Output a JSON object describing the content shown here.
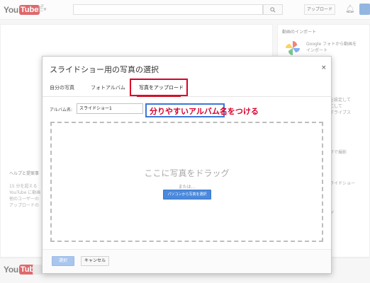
{
  "header": {
    "logo_you": "You",
    "logo_tube": "Tube",
    "logo_region": "JP",
    "guide_icon": "menu-icon",
    "search_placeholder": "",
    "upload_label": "アップロード"
  },
  "background": {
    "import_title": "動画のインポート",
    "import_desc_line1": "Google フォトから動画を",
    "import_desc_line2": "インポート",
    "right_snippets": [
      "を設定して",
      "にして",
      "すライブス",
      "ラで撮影",
      "ライドショー",
      "ゲ"
    ],
    "left_title": "ヘルプと提案事",
    "left_snippets": [
      "15 分を超える",
      "YouTube に動画",
      "他のユーザーの",
      "アップロードの"
    ]
  },
  "dialog": {
    "title": "スライドショー用の写真の選択",
    "close_label": "×",
    "tabs": [
      {
        "label": "自分の写真"
      },
      {
        "label": "フォトアルバム"
      },
      {
        "label": "写真をアップロード",
        "active": true
      }
    ],
    "album_label": "アルバム名:",
    "album_value": "スライドショー1",
    "annotation": "分りやすいアルバム名をつける",
    "drop_text": "ここに写真をドラッグ",
    "or_text": "または...",
    "pc_button": "パソコンから写真を選択",
    "select_button": "選択",
    "cancel_button": "キャンセル"
  },
  "colors": {
    "youtube_red": "#cc181e",
    "annotation_red": "#d9002c",
    "callout_blue": "#3a78d9",
    "button_blue": "#4a89dc"
  }
}
